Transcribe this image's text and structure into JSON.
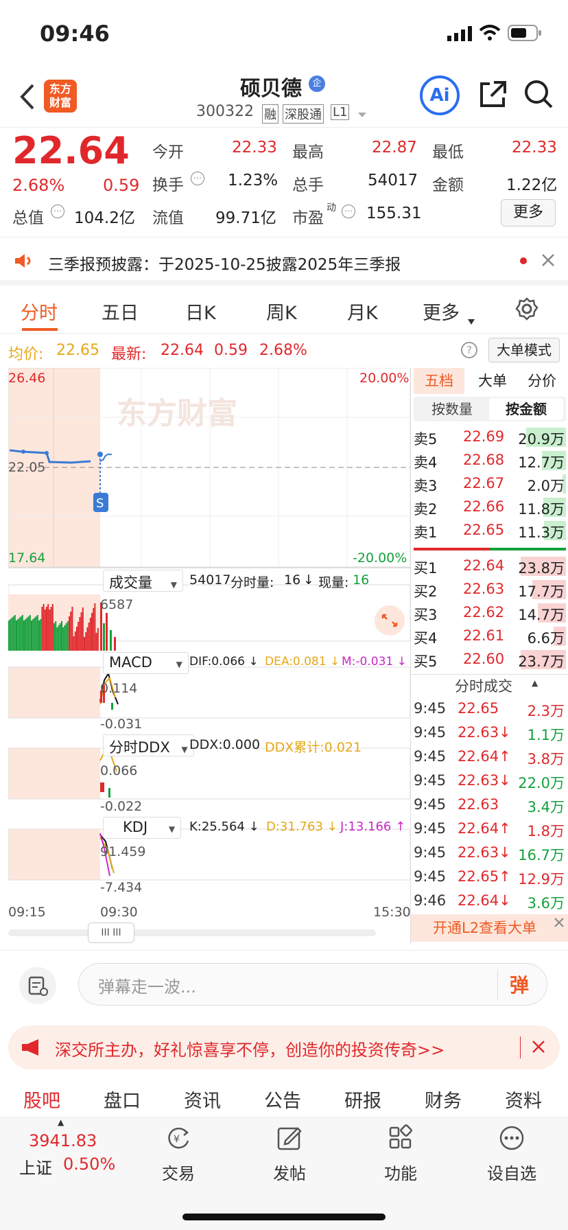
{
  "status": {
    "time": "09:46"
  },
  "header": {
    "stock_name": "硕贝德",
    "badge": "企",
    "code": "300322",
    "tags": [
      "融",
      "深股通",
      "L1"
    ],
    "logo_text": [
      "东方",
      "财富"
    ],
    "ai_label": "Ai"
  },
  "quote": {
    "price": "22.64",
    "pct": "2.68%",
    "change": "0.59",
    "fields": [
      {
        "label": "今开",
        "value": "22.33"
      },
      {
        "label": "最高",
        "value": "22.87"
      },
      {
        "label": "最低",
        "value": "22.33"
      },
      {
        "label": "换手",
        "value": "1.23%"
      },
      {
        "label": "总手",
        "value": "54017"
      },
      {
        "label": "金额",
        "value": "1.22亿"
      },
      {
        "label": "总值",
        "value": "104.2亿"
      },
      {
        "label": "流值",
        "value": "99.71亿"
      },
      {
        "label": "市盈",
        "sup": "动",
        "value": "155.31"
      }
    ],
    "more": "更多"
  },
  "notice": {
    "text": "三季报预披露：于2025-10-25披露2025年三季报"
  },
  "tabs": [
    "分时",
    "五日",
    "日K",
    "周K",
    "月K",
    "更多"
  ],
  "chart": {
    "avg_label": "均价:",
    "avg": "22.65",
    "latest_label": "最新:",
    "latest": "22.64",
    "latest_change": "0.59",
    "latest_pct": "2.68%",
    "mode_button": "大单模式",
    "watermark": "东方财富",
    "price_top": "26.46",
    "price_mid": "22.05",
    "price_bot": "17.64",
    "pct_top": "20.00%",
    "pct_bot": "-20.00%",
    "volume": {
      "selector": "成交量",
      "total": "54017",
      "min_label": "分时量:",
      "min_val": "16",
      "arrow": "↓",
      "now_label": "现量:",
      "now_val": "16",
      "max": "6587"
    },
    "macd": {
      "selector": "MACD",
      "dif": "DIF:0.066 ↓",
      "dea": "DEA:0.081 ↓",
      "m": "M:-0.031 ↓",
      "top": "0.114",
      "bot": "-0.031"
    },
    "ddx": {
      "selector": "分时DDX",
      "ddx": "DDX:0.000",
      "ddx_sum": "DDX累计:0.021",
      "top": "0.066",
      "bot": "-0.022"
    },
    "kdj": {
      "selector": "KDJ",
      "k": "K:25.564 ↓",
      "d": "D:31.763 ↓",
      "j": "J:13.166 ↑",
      "top": "91.459",
      "bot": "-7.434"
    },
    "time_start": "09:15",
    "time_open": "09:30",
    "time_end": "15:30",
    "chart_data": {
      "type": "line",
      "x": [
        "09:30",
        "09:31",
        "09:32",
        "09:33",
        "09:34",
        "09:35",
        "09:36",
        "09:37"
      ],
      "series": [
        {
          "values": [
            22.33,
            22.36,
            22.4,
            22.55,
            22.6,
            22.64,
            22.62,
            22.64
          ]
        }
      ],
      "ylim": [
        17.64,
        26.46
      ]
    }
  },
  "orderbook": {
    "tabs": [
      "五档",
      "大单",
      "分价"
    ],
    "subtabs": [
      "按数量",
      "按金额"
    ],
    "sell": [
      {
        "label": "卖5",
        "price": "22.69",
        "amt": "20.9万",
        "fill": 0.88
      },
      {
        "label": "卖4",
        "price": "22.68",
        "amt": "12.7万",
        "fill": 0.53
      },
      {
        "label": "卖3",
        "price": "22.67",
        "amt": "2.0万",
        "fill": 0.08
      },
      {
        "label": "卖2",
        "price": "22.66",
        "amt": "11.8万",
        "fill": 0.5
      },
      {
        "label": "卖1",
        "price": "22.65",
        "amt": "11.3万",
        "fill": 0.48
      }
    ],
    "buy": [
      {
        "label": "买1",
        "price": "22.64",
        "amt": "23.8万",
        "fill": 1.0
      },
      {
        "label": "买2",
        "price": "22.63",
        "amt": "17.7万",
        "fill": 0.74
      },
      {
        "label": "买3",
        "price": "22.62",
        "amt": "14.7万",
        "fill": 0.62
      },
      {
        "label": "买4",
        "price": "22.61",
        "amt": "6.6万",
        "fill": 0.28
      },
      {
        "label": "买5",
        "price": "22.60",
        "amt": "23.7万",
        "fill": 1.0
      }
    ],
    "trades_title": "分时成交",
    "trades": [
      {
        "t": "9:45",
        "p": "22.65",
        "d": "",
        "v": "2.3万",
        "c": "red"
      },
      {
        "t": "9:45",
        "p": "22.63",
        "d": "↓",
        "v": "1.1万",
        "c": "green"
      },
      {
        "t": "9:45",
        "p": "22.64",
        "d": "↑",
        "v": "3.8万",
        "c": "red"
      },
      {
        "t": "9:45",
        "p": "22.63",
        "d": "↓",
        "v": "22.0万",
        "c": "green"
      },
      {
        "t": "9:45",
        "p": "22.63",
        "d": "",
        "v": "3.4万",
        "c": "green"
      },
      {
        "t": "9:45",
        "p": "22.64",
        "d": "↑",
        "v": "1.8万",
        "c": "red"
      },
      {
        "t": "9:45",
        "p": "22.63",
        "d": "↓",
        "v": "16.7万",
        "c": "green"
      },
      {
        "t": "9:45",
        "p": "22.65",
        "d": "↑",
        "v": "12.9万",
        "c": "red"
      },
      {
        "t": "9:46",
        "p": "22.64",
        "d": "↓",
        "v": "3.6万",
        "c": "green"
      }
    ],
    "l2_banner": "开通L2查看大单"
  },
  "danmaku": {
    "placeholder": "弹幕走一波...",
    "btn": "弹"
  },
  "promo": {
    "text": "深交所主办，好礼惊喜享不停，创造你的投资传奇>>"
  },
  "bottom_tabs": [
    "股吧",
    "盘口",
    "资讯",
    "公告",
    "研报",
    "财务",
    "资料"
  ],
  "dock": {
    "index_value": "3941.83",
    "index_name": "上证",
    "index_pct": "0.50%",
    "items": [
      "交易",
      "发帖",
      "功能",
      "设自选"
    ]
  }
}
